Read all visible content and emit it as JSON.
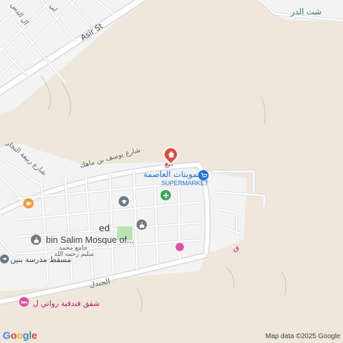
{
  "map": {
    "colors": {
      "land": "#efe7db",
      "road": "#ffffff",
      "road_casing": "#d6d9de",
      "urban": "#f3f3f3",
      "park": "#b7e4b0",
      "red_pin": "#e14b3b",
      "blue_pin": "#1a73e8",
      "green_pin": "#34a853",
      "gray_pin": "#6f7a83",
      "orange_pin": "#f29b38",
      "pink_pin": "#e44ba4"
    },
    "labels": {
      "asir_st": "Asir St",
      "top_arabic_1": "ال الدس",
      "top_arabic_2": "لي",
      "top_right_arabic": "شت الدر",
      "yousef_st": "شارع يوسف بن ماهك",
      "rabia_st": "شارع ربيعة النجار",
      "pin_top_arabic": "الع",
      "supermarket_ar": "تموينات العاصمة",
      "supermarket_en": "SUPERMARKET",
      "mosque_en": "bin Salim Mosque of...",
      "mosque_prefix": "ed",
      "mosque_ar_1": "جامع محمد",
      "mosque_ar_2": "سليم رحمه الله",
      "school_ar": "مسقط مدرسة بنين",
      "jandal": "الجندل",
      "apartments_ar": "شقق فندقية رواتي ل",
      "right_edge_ar": "ق"
    },
    "icons": {
      "red": "home-pin-icon",
      "blue": "shopping-cart-icon",
      "green": "store-flower-icon",
      "school": "school-icon",
      "mosque_top": "mosque-icon",
      "mosque_left": "mosque-icon",
      "cafe": "coffee-icon",
      "hotel": "bed-icon",
      "generic": "place-icon"
    },
    "attribution": "Map data ©2025 Google",
    "logo": {
      "letters": [
        "G",
        "o",
        "o",
        "g",
        "l",
        "e"
      ],
      "colors": [
        "#4285f4",
        "#ea4335",
        "#fbbc05",
        "#4285f4",
        "#34a853",
        "#ea4335"
      ]
    }
  }
}
